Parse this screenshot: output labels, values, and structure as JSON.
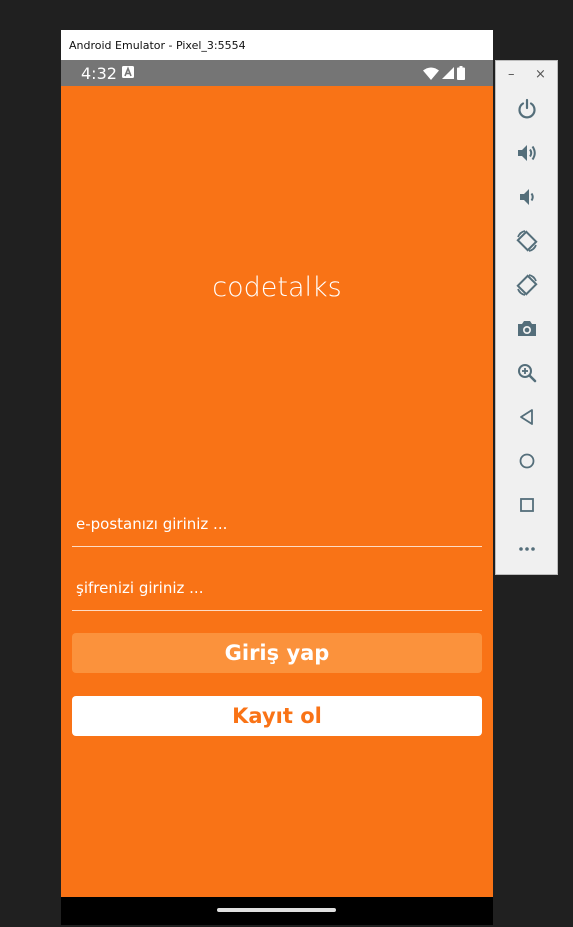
{
  "window": {
    "title": "Android Emulator - Pixel_3:5554"
  },
  "status_bar": {
    "time": "4:32",
    "icons": [
      "a-notification-icon",
      "wifi-icon",
      "signal-icon",
      "battery-icon"
    ]
  },
  "app": {
    "title": "codetalks",
    "email_placeholder": "e-postanızı giriniz ...",
    "password_placeholder": "şifrenizi giriniz ...",
    "login_label": "Giriş yap",
    "register_label": "Kayıt ol"
  },
  "side_panel": {
    "minimize_label": "–",
    "close_label": "×",
    "buttons": [
      "power-icon",
      "volume-up-icon",
      "volume-down-icon",
      "rotate-left-icon",
      "rotate-right-icon",
      "camera-icon",
      "zoom-icon",
      "back-icon",
      "home-icon",
      "overview-icon",
      "more-icon"
    ]
  },
  "colors": {
    "primary": "#f97316",
    "button_light": "#fb923c",
    "white": "#ffffff",
    "panel_icon": "#546e7a"
  }
}
